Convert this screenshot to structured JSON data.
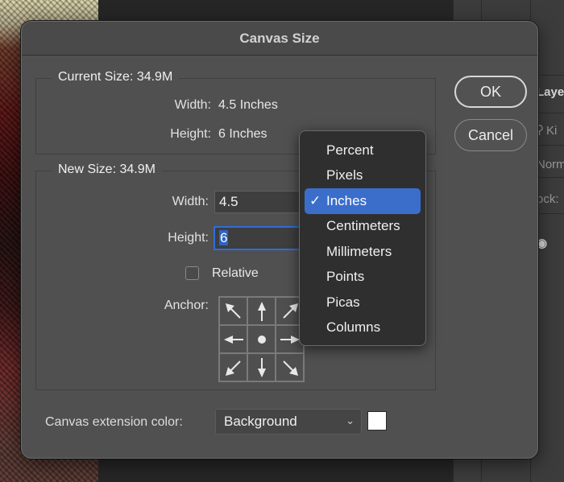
{
  "background": {
    "panel": {
      "title": "Laye",
      "search_text": "Ki",
      "blend_mode": "Norm",
      "lock_label": "ock:"
    }
  },
  "dialog": {
    "title": "Canvas Size",
    "current_size": {
      "title": "Current Size: 34.9M",
      "width_label": "Width:",
      "width_value": "4.5 Inches",
      "height_label": "Height:",
      "height_value": "6 Inches"
    },
    "new_size": {
      "title": "New Size: 34.9M",
      "width_label": "Width:",
      "width_value": "4.5",
      "height_label": "Height:",
      "height_value": "6",
      "relative_label": "Relative",
      "relative_checked": false,
      "anchor_label": "Anchor:",
      "anchor_cells": [
        {
          "name": "anchor-top-left",
          "icon": "arrow-up-left-icon"
        },
        {
          "name": "anchor-top",
          "icon": "arrow-up-icon"
        },
        {
          "name": "anchor-top-right",
          "icon": "arrow-up-right-icon"
        },
        {
          "name": "anchor-left",
          "icon": "arrow-left-icon"
        },
        {
          "name": "anchor-center",
          "icon": "dot-icon"
        },
        {
          "name": "anchor-right",
          "icon": "arrow-right-icon"
        },
        {
          "name": "anchor-bottom-left",
          "icon": "arrow-down-left-icon"
        },
        {
          "name": "anchor-bottom",
          "icon": "arrow-down-icon"
        },
        {
          "name": "anchor-bottom-right",
          "icon": "arrow-down-right-icon"
        }
      ]
    },
    "extension_color": {
      "label": "Canvas extension color:",
      "selected": "Background",
      "swatch_color": "#ffffff"
    },
    "buttons": {
      "ok": "OK",
      "cancel": "Cancel"
    }
  },
  "unit_menu": {
    "selected": "Inches",
    "check_glyph": "✓",
    "items": [
      "Percent",
      "Pixels",
      "Inches",
      "Centimeters",
      "Millimeters",
      "Points",
      "Picas",
      "Columns"
    ]
  },
  "colors": {
    "accent": "#3b6ecb",
    "dialog_bg": "#505050",
    "menu_bg": "#2f2f2f"
  }
}
